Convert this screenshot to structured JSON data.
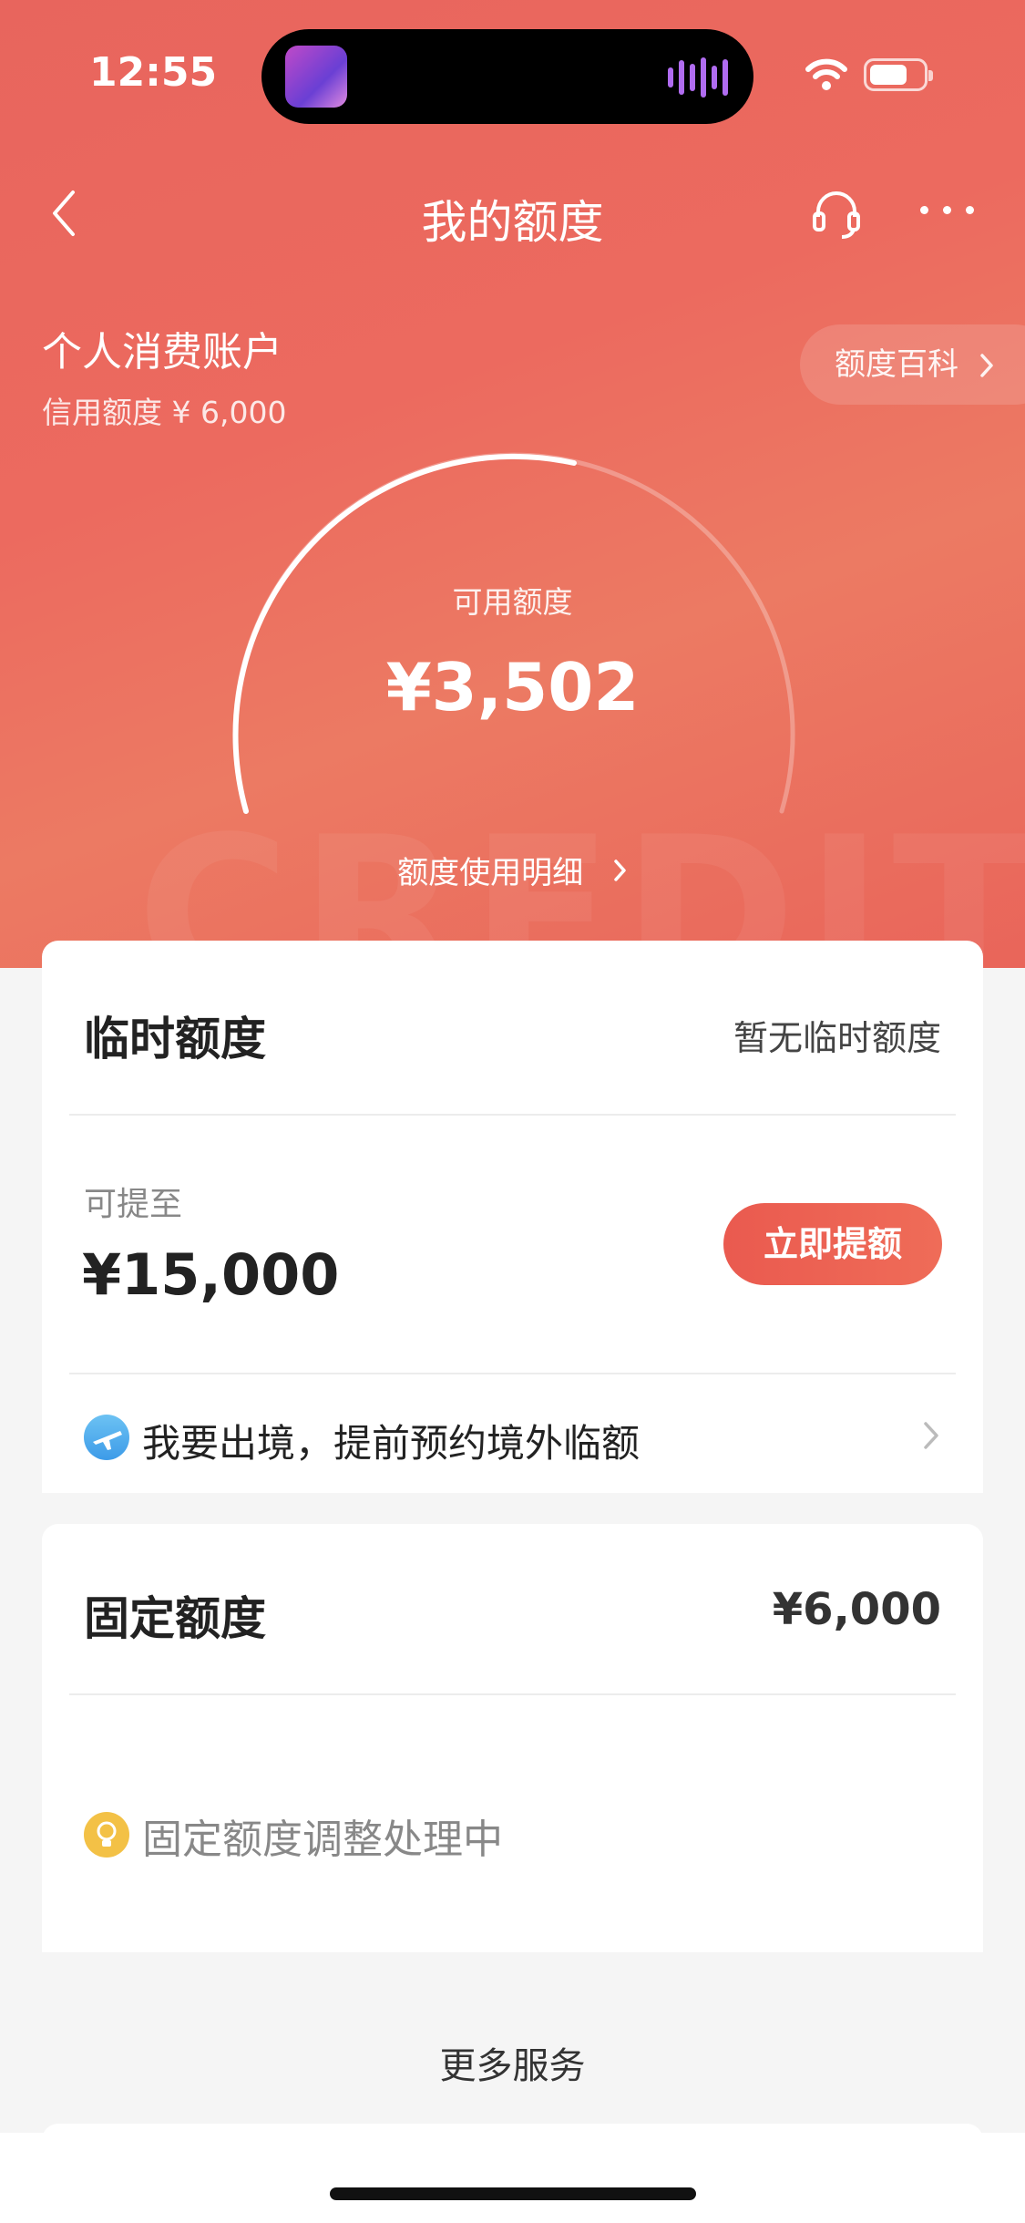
{
  "status_bar": {
    "time": "12:55"
  },
  "nav": {
    "title": "我的额度"
  },
  "account": {
    "title": "个人消费账户",
    "credit_limit_text": "信用额度 ¥ 6,000",
    "encyclopedia_label": "额度百科"
  },
  "gauge": {
    "available_label": "可用额度",
    "available_value": "¥3,502",
    "detail_link": "额度使用明细",
    "available_fraction": 0.58
  },
  "watermark": "CREDIT",
  "temporary": {
    "title": "临时额度",
    "status": "暂无临时额度",
    "upto_label": "可提至",
    "upto_value": "¥15,000",
    "raise_button": "立即提额",
    "travel_text": "我要出境，提前预约境外临额"
  },
  "fixed": {
    "title": "固定额度",
    "amount": "¥6,000",
    "processing_text": "固定额度调整处理中"
  },
  "more_services": "更多服务",
  "colors": {
    "header_red": "#e8655d",
    "button_red": "#ea5a4f",
    "page_bg": "#f5f5f5"
  },
  "icons": [
    "back-icon",
    "headset-icon",
    "more-icon",
    "chevron-right-icon",
    "plane-icon",
    "bulb-icon",
    "wifi-icon",
    "battery-icon"
  ]
}
